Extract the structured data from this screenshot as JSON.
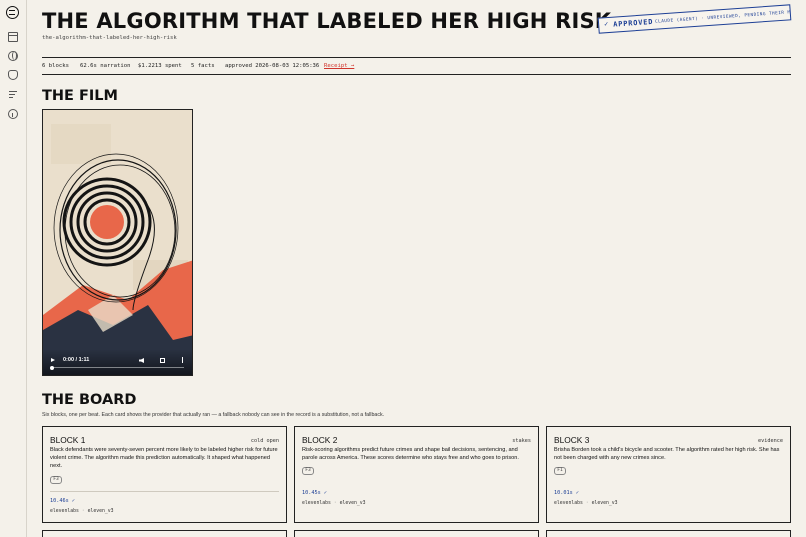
{
  "page": {
    "title": "THE ALGORITHM THAT LABELED HER HIGH RISK",
    "slug": "the-algorithm-that-labeled-her-high-risk"
  },
  "stamp": {
    "check": "✓",
    "word": "APPROVED",
    "note": "CLAUDE (AGENT) · UNREVIEWED, PENDING THEIR MOODY"
  },
  "stats": {
    "blocks": "6 blocks",
    "narration": "62.6s narration",
    "spent": "$1.2213 spent",
    "facts": "5 facts",
    "approved": "approved 2026-08-03 12:05:36",
    "receipt": "Receipt →"
  },
  "film": {
    "heading": "THE FILM",
    "time": "0:00 / 1:11",
    "progress_fraction": 0
  },
  "board": {
    "heading": "THE BOARD",
    "subtitle": "Six blocks, one per beat. Each card shows the provider that actually ran — a fallback nobody can see in the record is a substitution, not a fallback.",
    "cards": [
      {
        "name": "BLOCK 1",
        "tag": "cold open",
        "text": "Black defendants were seventy-seven percent more likely to be labeled higher risk for future violent crime. The algorithm made this prediction automatically. It shaped what happened next.",
        "chip": "F3",
        "duration": "10.46s ✓",
        "provider": "elevenlabs",
        "voice": "eleven_v3"
      },
      {
        "name": "BLOCK 2",
        "tag": "stakes",
        "text": "Risk-scoring algorithms predict future crimes and shape bail decisions, sentencing, and parole across America. These scores determine who stays free and who goes to prison.",
        "chip": "F3",
        "duration": "10.45s ✓",
        "provider": "elevenlabs",
        "voice": "eleven_v3"
      },
      {
        "name": "BLOCK 3",
        "tag": "evidence",
        "text": "Brisha Borden took a child's bicycle and scooter. The algorithm rated her high risk. She has not been charged with any new crimes since.",
        "chip": "F1",
        "duration": "10.01s ✓",
        "provider": "elevenlabs",
        "voice": "eleven_v3"
      }
    ]
  },
  "colors": {
    "background": "#f4f1ea",
    "stamp_blue": "#1d3f95",
    "receipt_red": "#d0342c",
    "art_orange": "#e8674a"
  },
  "icons": {
    "logo": "app-logo-icon",
    "rail": [
      "calendar-icon",
      "globe-icon",
      "shield-icon",
      "list-icon",
      "info-icon"
    ],
    "video": [
      "play-icon",
      "volume-icon",
      "fullscreen-icon",
      "more-options-icon"
    ]
  }
}
